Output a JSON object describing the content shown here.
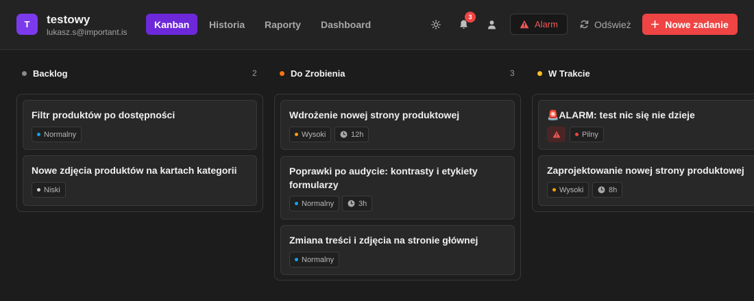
{
  "user": {
    "initial": "T",
    "name": "testowy",
    "email": "lukasz.s@important.is"
  },
  "nav": {
    "tabs": [
      {
        "label": "Kanban",
        "active": true
      },
      {
        "label": "Historia"
      },
      {
        "label": "Raporty"
      },
      {
        "label": "Dashboard"
      }
    ]
  },
  "header": {
    "notification_count": "3",
    "alarm_label": "Alarm",
    "refresh_label": "Odśwież",
    "new_task_label": "Nowe zadanie",
    "icons": [
      "sun-icon",
      "bell-icon",
      "user-icon",
      "warning-icon",
      "refresh-icon",
      "plus-icon"
    ]
  },
  "colors": {
    "accent": "#6d28d9",
    "danger": "#ef4444",
    "backlog": "#8b8b8b",
    "todo": "#f97316",
    "in_progress": "#fbbf24",
    "priority_normal": "#0ea5e9",
    "priority_low": "#d4d4d4",
    "priority_high": "#f59e0b",
    "priority_urgent": "#ef4444"
  },
  "columns": [
    {
      "title": "Backlog",
      "count": "2",
      "cards": [
        {
          "title": "Filtr produktów po dostępności",
          "priority": "Normalny"
        },
        {
          "title": "Nowe zdjęcia produktów na kartach kategorii",
          "priority": "Niski"
        }
      ]
    },
    {
      "title": "Do Zrobienia",
      "count": "3",
      "cards": [
        {
          "title": "Wdrożenie nowej strony produktowej",
          "priority": "Wysoki",
          "estimate": "12h"
        },
        {
          "title": "Poprawki po audycie: kontrasty i etykiety formularzy",
          "priority": "Normalny",
          "estimate": "3h"
        },
        {
          "title": "Zmiana treści i zdjęcia na stronie głównej",
          "priority": "Normalny"
        }
      ]
    },
    {
      "title": "W Trakcie",
      "cards": [
        {
          "title": "🚨ALARM: test nic się nie dzieje",
          "priority": "Pilny"
        },
        {
          "title": "Zaprojektowanie nowej strony produktowej",
          "priority": "Wysoki",
          "estimate": "8h"
        }
      ]
    }
  ]
}
